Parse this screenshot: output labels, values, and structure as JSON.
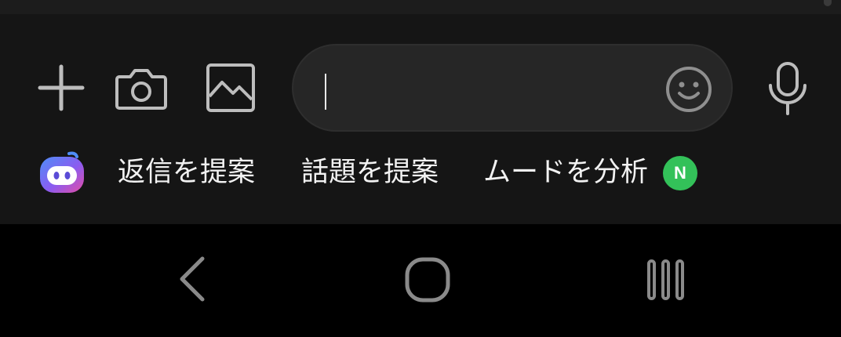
{
  "composer": {
    "input": {
      "value": "",
      "placeholder": ""
    },
    "buttons": {
      "plus_icon": "plus-icon",
      "camera_icon": "camera-icon",
      "image_icon": "image-icon",
      "emoji_icon": "smiley-icon",
      "mic_icon": "microphone-icon"
    }
  },
  "suggestions": {
    "ai_icon": "ai-assistant-icon",
    "items": [
      {
        "label": "返信を提案"
      },
      {
        "label": "話題を提案"
      },
      {
        "label": "ムードを分析"
      }
    ],
    "new_badge": "N"
  },
  "navigation": {
    "back_icon": "back-icon",
    "home_icon": "home-icon",
    "recents_icon": "recents-icon"
  },
  "colors": {
    "background": "#000000",
    "composer_background": "#151515",
    "input_background": "#262626",
    "icon_color": "#bdbdbd",
    "badge_color": "#33c159"
  }
}
